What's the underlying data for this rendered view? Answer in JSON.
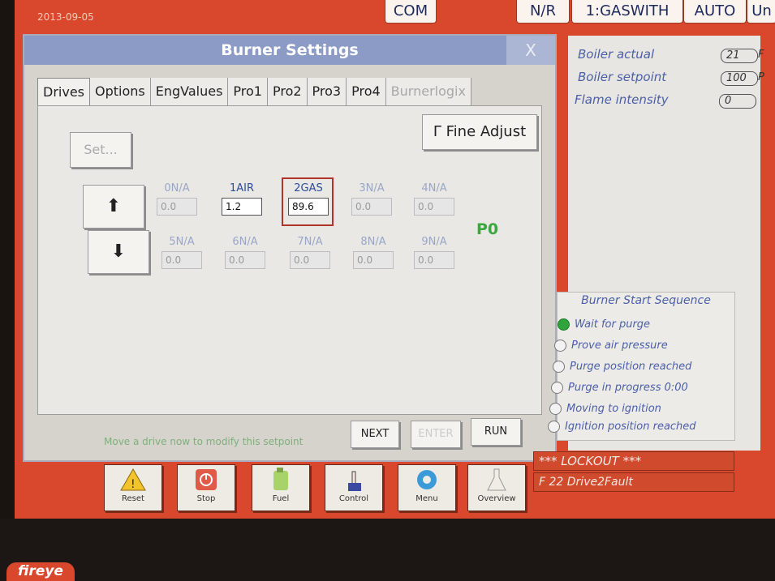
{
  "header": {
    "date": "2013-09-05",
    "com_label": "COM",
    "nr_label": "N/R",
    "fuel_profile": "1:GASWITH",
    "mode": "AUTO",
    "units": "Un"
  },
  "dialog": {
    "title": "Burner Settings",
    "close_glyph": "X",
    "tabs": [
      "Drives",
      "Options",
      "EngValues",
      "Pro1",
      "Pro2",
      "Pro3",
      "Pro4",
      "Burnerlogix"
    ],
    "fine_adjust": "Γ Fine Adjust",
    "set_label": "Set...",
    "up_arrow": "⬆",
    "down_arrow": "⬇",
    "profile_indicator": "P0",
    "drives": [
      {
        "name": "0N/A",
        "value": "0.0"
      },
      {
        "name": "1AIR",
        "value": "1.2"
      },
      {
        "name": "2GAS",
        "value": "89.6"
      },
      {
        "name": "3N/A",
        "value": "0.0"
      },
      {
        "name": "4N/A",
        "value": "0.0"
      },
      {
        "name": "5N/A",
        "value": "0.0"
      },
      {
        "name": "6N/A",
        "value": "0.0"
      },
      {
        "name": "7N/A",
        "value": "0.0"
      },
      {
        "name": "8N/A",
        "value": "0.0"
      },
      {
        "name": "9N/A",
        "value": "0.0"
      }
    ],
    "hint": "Move a drive now to modify this setpoint",
    "next_label": "NEXT",
    "enter_label": "ENTER",
    "run_label": "RUN"
  },
  "status": {
    "boiler_actual_label": "Boiler actual",
    "boiler_actual_value": "21",
    "boiler_actual_unit": "F",
    "boiler_setpoint_label": "Boiler setpoint",
    "boiler_setpoint_value": "100",
    "boiler_setpoint_unit": "P",
    "flame_intensity_label": "Flame intensity",
    "flame_intensity_value": "0"
  },
  "sequence": {
    "title": "Burner Start Sequence",
    "steps": [
      "Wait for purge",
      "Prove air pressure",
      "Purge position reached",
      "Purge in progress 0:00",
      "Moving to ignition",
      "Ignition position reached"
    ]
  },
  "lockout": "*** LOCKOUT ***",
  "fault": "F 22 Drive2Fault",
  "bottom_buttons": [
    "Reset",
    "Stop",
    "Fuel",
    "Control",
    "Menu",
    "Overview"
  ],
  "brand": "fireye",
  "colors": {
    "accent": "#d9472c",
    "active_step": "#2ea43b",
    "profile": "#3aa83c"
  }
}
